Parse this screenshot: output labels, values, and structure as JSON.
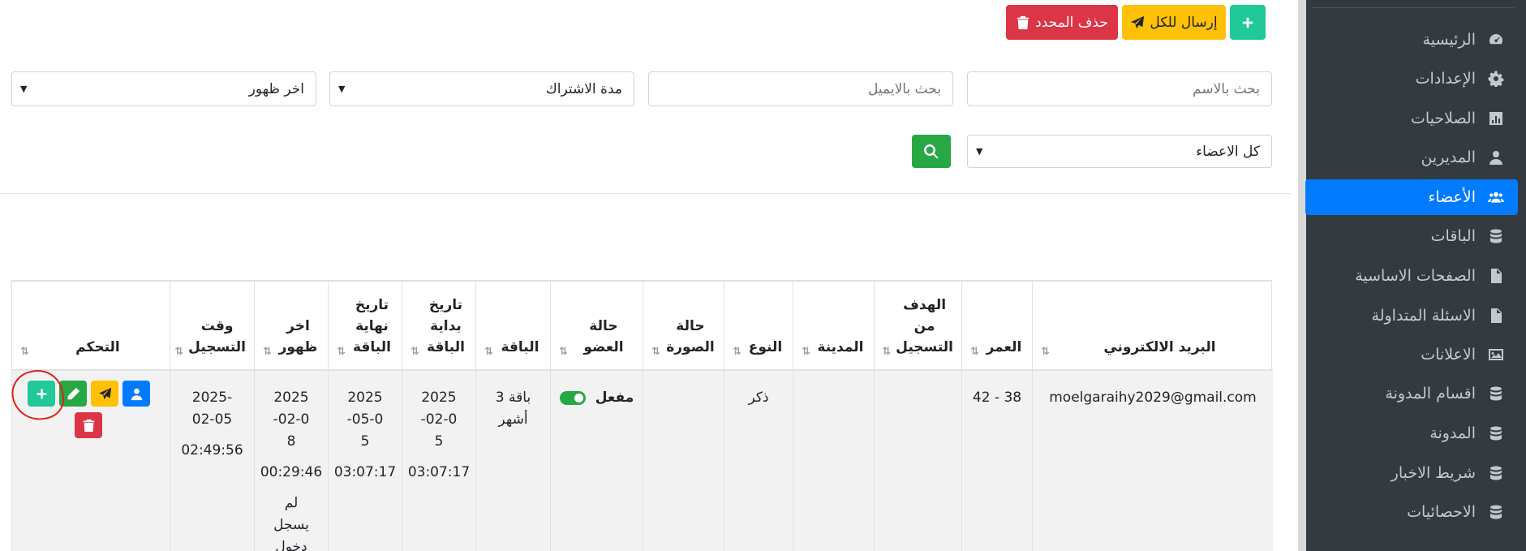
{
  "sidebar": {
    "items": [
      {
        "label": "الرئيسية",
        "icon": "gauge-icon"
      },
      {
        "label": "الإعدادات",
        "icon": "gear-icon"
      },
      {
        "label": "الصلاحيات",
        "icon": "chart-icon"
      },
      {
        "label": "المديرين",
        "icon": "user-tie-icon"
      },
      {
        "label": "الأعضاء",
        "icon": "users-icon",
        "active": true
      },
      {
        "label": "الباقات",
        "icon": "database-icon"
      },
      {
        "label": "الصفحات الاساسية",
        "icon": "file-icon"
      },
      {
        "label": "الاسئلة المتداولة",
        "icon": "file-icon"
      },
      {
        "label": "الاعلانات",
        "icon": "image-icon"
      },
      {
        "label": "اقسام المدونة",
        "icon": "database-icon"
      },
      {
        "label": "المدونة",
        "icon": "database-icon"
      },
      {
        "label": "شريط الاخبار",
        "icon": "database-icon"
      },
      {
        "label": "الاحصائيات",
        "icon": "database-icon"
      }
    ]
  },
  "toolbar": {
    "send_all_label": "إرسال للكل",
    "delete_selected_label": "حذف المحدد"
  },
  "filters": {
    "search_name_placeholder": "بحث بالاسم",
    "search_email_placeholder": "بحث بالايميل",
    "subscription_duration": "مدة الاشتراك",
    "last_seen": "اخر ظهور",
    "members_filter": "كل الاعضاء"
  },
  "table": {
    "headers": {
      "email": "البريد الالكتروني",
      "age": "العمر",
      "goal": "الهدف من التسجيل",
      "city": "المدينة",
      "gender": "النوع",
      "photo_status": "حالة الصورة",
      "member_status": "حالة العضو",
      "package": "الباقة",
      "package_start": "تاريخ بداية الباقة",
      "package_end": "تاريخ نهاية الباقة",
      "last_seen": "اخر ظهور",
      "registered_at": "وقت التسجيل",
      "control": "التحكم"
    },
    "rows": [
      {
        "email": "moelgaraihy2029@gmail.com",
        "age": "38 - 42",
        "goal": "",
        "city": "",
        "gender": "ذكر",
        "photo_status": "",
        "member_status": "مفعل",
        "package": "باقة 3 أشهر",
        "package_start_date": "2025-02-05",
        "package_start_time": "03:07:17",
        "package_end_date": "2025-05-05",
        "package_end_time": "03:07:17",
        "last_seen_date": "2025-02-08",
        "last_seen_time": "00:29:46",
        "last_seen_note": "لم يسجل دخول",
        "registered_date": "2025-02-05",
        "registered_time": "02:49:56"
      }
    ]
  },
  "colors": {
    "sidebar_bg": "#343a40",
    "active_item": "#007bff",
    "green": "#20c997",
    "yellow": "#ffc107",
    "red": "#dc3545",
    "annotation": "#e0201f"
  }
}
